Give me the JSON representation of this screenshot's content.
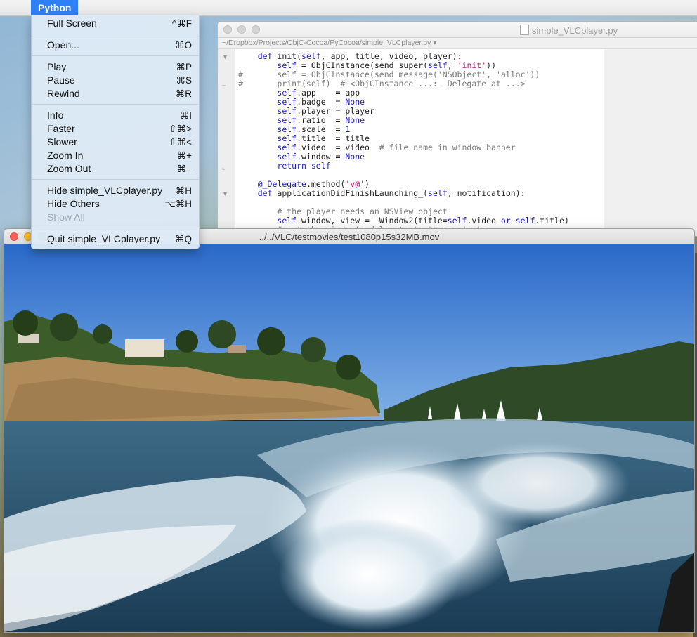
{
  "menubar": {
    "apple_symbol": "",
    "app_name": "Python"
  },
  "menu": {
    "groups": [
      [
        {
          "label": "Full Screen",
          "shortcut": "^⌘F"
        }
      ],
      [
        {
          "label": "Open...",
          "shortcut": "⌘O"
        }
      ],
      [
        {
          "label": "Play",
          "shortcut": "⌘P"
        },
        {
          "label": "Pause",
          "shortcut": "⌘S"
        },
        {
          "label": "Rewind",
          "shortcut": "⌘R"
        }
      ],
      [
        {
          "label": "Info",
          "shortcut": "⌘I"
        },
        {
          "label": "Faster",
          "shortcut": "⇧⌘>"
        },
        {
          "label": "Slower",
          "shortcut": "⇧⌘<"
        },
        {
          "label": "Zoom In",
          "shortcut": "⌘+"
        },
        {
          "label": "Zoom Out",
          "shortcut": "⌘−"
        }
      ],
      [
        {
          "label": "Hide simple_VLCplayer.py",
          "shortcut": "⌘H"
        },
        {
          "label": "Hide Others",
          "shortcut": "⌥⌘H"
        },
        {
          "label": "Show All",
          "shortcut": "",
          "disabled": true
        }
      ],
      [
        {
          "label": "Quit simple_VLCplayer.py",
          "shortcut": "⌘Q"
        }
      ]
    ]
  },
  "editor": {
    "title": "simple_VLCplayer.py",
    "path": "~/Dropbox/Projects/ObjC-Cocoa/PyCocoa/simple_VLCplayer.py ▾",
    "code_lines": [
      "    def init(self, app, title, video, player):",
      "        self = ObjCInstance(send_super(self, 'init'))",
      "#       self = ObjCInstance(send_message('NSObject', 'alloc'))",
      "#       print(self)  # <ObjCInstance ...: _Delegate at ...>",
      "        self.app    = app",
      "        self.badge  = None",
      "        self.player = player",
      "        self.ratio  = None",
      "        self.scale  = 1",
      "        self.title  = title",
      "        self.video  = video  # file name in window banner",
      "        self.window = None",
      "        return self",
      "",
      "    @_Delegate.method('v@')",
      "    def applicationDidFinishLaunching_(self, notification):",
      "",
      "        # the player needs an NSView object",
      "        self.window, view = _Window2(title=self.video or self.title)",
      "        # set the window's delegate to the app's to"
    ]
  },
  "video_window": {
    "title": "../../VLC/testmovies/test1080p15s32MB.mov",
    "colors": {
      "close": "#fc5f57",
      "minimize": "#fdbc2e",
      "zoom": "#2ac840"
    }
  }
}
